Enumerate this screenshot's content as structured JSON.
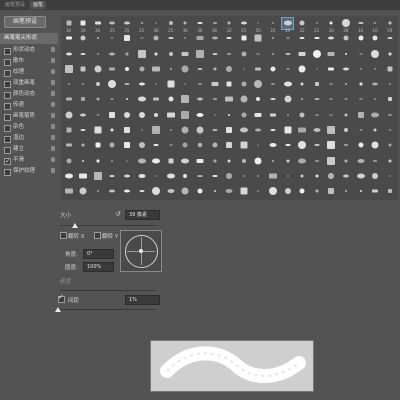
{
  "tabs": [
    {
      "label": "画笔预设",
      "active": false
    },
    {
      "label": "画笔",
      "active": true
    }
  ],
  "left_panel": {
    "presets_button": "画笔预设",
    "items": [
      {
        "label": "画笔笔尖形状",
        "header": true,
        "checked": null
      },
      {
        "label": "形状动态",
        "checked": false
      },
      {
        "label": "散布",
        "checked": false
      },
      {
        "label": "纹理",
        "checked": false
      },
      {
        "label": "双重画笔",
        "checked": false
      },
      {
        "label": "颜色动态",
        "checked": false
      },
      {
        "label": "传递",
        "checked": false
      },
      {
        "label": "画笔笔势",
        "checked": false
      },
      {
        "label": "杂色",
        "checked": false
      },
      {
        "label": "湿边",
        "checked": false
      },
      {
        "label": "建立",
        "checked": false
      },
      {
        "label": "平滑",
        "checked": true
      },
      {
        "label": "保护纹理",
        "checked": false
      }
    ]
  },
  "brush_grid": {
    "selected_index": 15,
    "row1_numbers": [
      "30",
      "30",
      "30",
      "25",
      "25",
      "25",
      "36",
      "25",
      "36",
      "36",
      "36",
      "32",
      "25",
      "50",
      "25",
      "39",
      "32",
      "25",
      "30",
      "28",
      "16",
      "10",
      "59"
    ]
  },
  "controls": {
    "size_label": "大小",
    "size_value": "39 像素",
    "flip_x": "翻转 X",
    "flip_y": "翻转 Y",
    "angle_label": "角度:",
    "angle_value": "0°",
    "roundness_label": "圆度:",
    "roundness_value": "100%",
    "hardness_label": "硬度",
    "spacing_label": "间距",
    "spacing_checked": true,
    "spacing_value": "1%"
  },
  "colors": {
    "panel": "#535353",
    "grid": "#4a4a4a",
    "highlight": "#6aa6c8"
  }
}
